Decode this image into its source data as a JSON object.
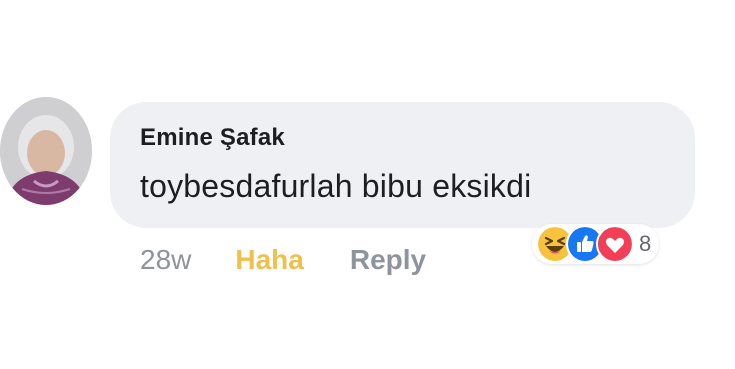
{
  "comment": {
    "author": "Emine Şafak",
    "text": "toybesdafurlah bibu eksikdi",
    "timestamp": "28w",
    "reaction_label": "Haha",
    "reply_label": "Reply",
    "reactions": {
      "icons": [
        "haha-icon",
        "like-icon",
        "love-icon"
      ],
      "count": "8"
    }
  },
  "colors": {
    "bubble": "#eef0f3",
    "haha_label": "#f0c04d",
    "meta_gray": "#8d949e",
    "like_blue": "#1877f2",
    "love_red": "#f33e58"
  }
}
